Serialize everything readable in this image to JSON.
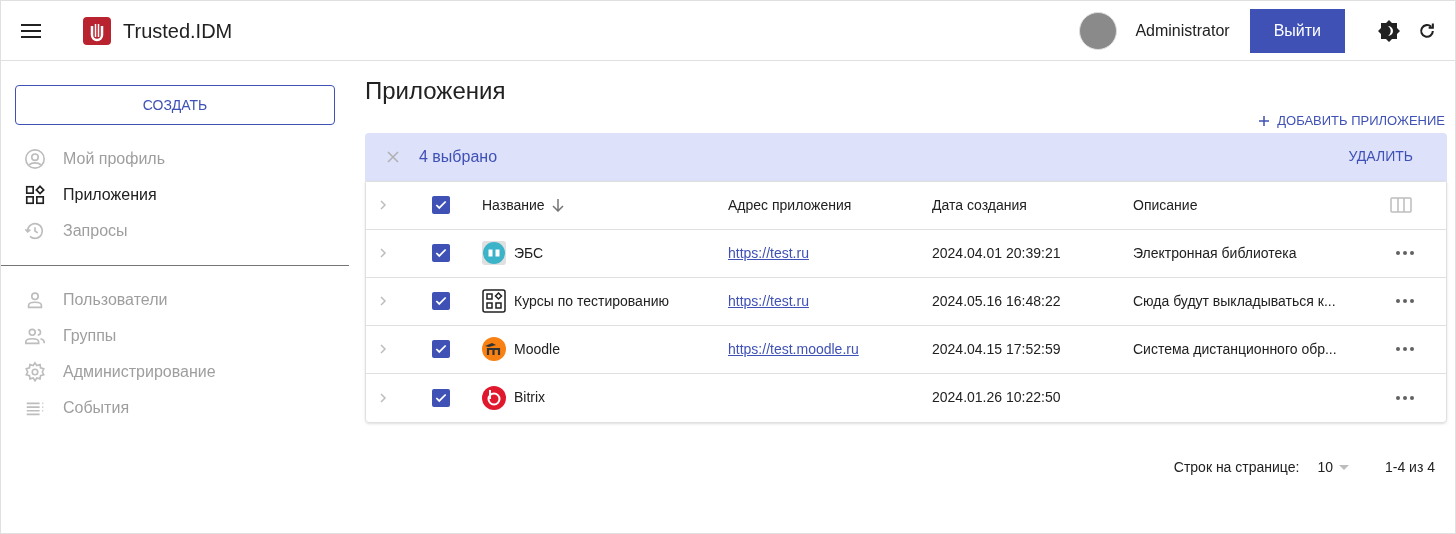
{
  "header": {
    "brand": "Trusted.IDM",
    "user": "Administrator",
    "logout": "Выйти"
  },
  "sidebar": {
    "create": "СОЗДАТЬ",
    "groups": [
      [
        {
          "label": "Мой профиль",
          "kind": "profile",
          "selected": false
        },
        {
          "label": "Приложения",
          "kind": "apps",
          "selected": true
        },
        {
          "label": "Запросы",
          "kind": "history",
          "selected": false
        }
      ],
      [
        {
          "label": "Пользователи",
          "kind": "user",
          "selected": false
        },
        {
          "label": "Группы",
          "kind": "group",
          "selected": false
        },
        {
          "label": "Администрирование",
          "kind": "gear",
          "selected": false
        },
        {
          "label": "События",
          "kind": "list",
          "selected": false
        }
      ]
    ]
  },
  "page": {
    "title": "Приложения",
    "add": "ДОБАВИТЬ ПРИЛОЖЕНИЕ"
  },
  "selection": {
    "count": "4 выбрано",
    "delete": "УДАЛИТЬ"
  },
  "table": {
    "all_checked": true,
    "columns": [
      "Название",
      "Адрес приложения",
      "Дата создания",
      "Описание"
    ],
    "rows": [
      {
        "checked": true,
        "kind": "book",
        "name": "ЭБС",
        "url": "https://test.ru",
        "created": "2024.04.01 20:39:21",
        "description": "Электронная библиотека"
      },
      {
        "checked": true,
        "kind": "grid",
        "name": "Курсы по тестированию",
        "url": "https://test.ru",
        "created": "2024.05.16 16:48:22",
        "description": "Сюда будут выкладываться к..."
      },
      {
        "checked": true,
        "kind": "moodle",
        "name": "Moodle",
        "url": "https://test.moodle.ru",
        "created": "2024.04.15 17:52:59",
        "description": "Система дистанционного обр..."
      },
      {
        "checked": true,
        "kind": "bitrix",
        "name": "Bitrix",
        "created": "2024.01.26 10:22:50"
      }
    ]
  },
  "pagination": {
    "label": "Строк на странице:",
    "per_page": "10",
    "range": "1-4 из 4"
  }
}
